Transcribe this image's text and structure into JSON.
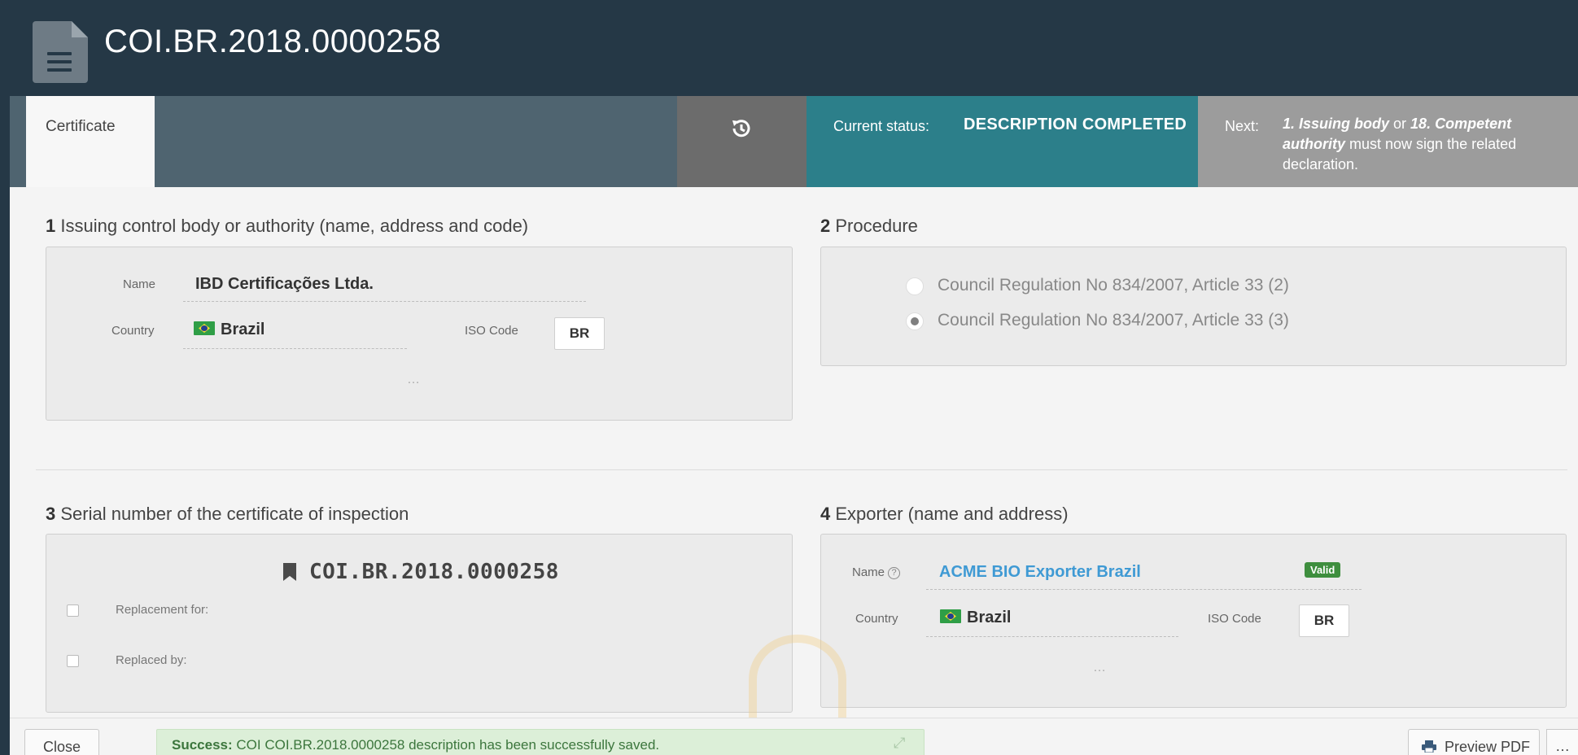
{
  "header": {
    "title": "COI.BR.2018.0000258"
  },
  "tabs": {
    "certificate": "Certificate"
  },
  "status": {
    "current_label": "Current status:",
    "current_value": "DESCRIPTION COMPLETED",
    "next_label": "Next:",
    "next_part1": "1. Issuing body",
    "next_or": " or ",
    "next_part2": "18. Competent authority",
    "next_rest": " must now sign the related declaration."
  },
  "section1": {
    "number": "1",
    "title": "Issuing control body or authority (name, address and code)",
    "name_label": "Name",
    "name_value": "IBD Certificações Ltda.",
    "country_label": "Country",
    "country_value": "Brazil",
    "iso_label": "ISO Code",
    "iso_value": "BR",
    "more": "…"
  },
  "section2": {
    "number": "2",
    "title": "Procedure",
    "options": [
      "Council Regulation No 834/2007, Article 33 (2)",
      "Council Regulation No 834/2007, Article 33 (3)"
    ],
    "selected_index": 1
  },
  "section3": {
    "number": "3",
    "title": "Serial number of the certificate of inspection",
    "serial": "COI.BR.2018.0000258",
    "replacement_for": "Replacement for:",
    "replaced_by": "Replaced by:"
  },
  "section4": {
    "number": "4",
    "title": "Exporter (name and address)",
    "name_label": "Name",
    "help": "?",
    "name_value": "ACME BIO Exporter Brazil",
    "badge": "Valid",
    "country_label": "Country",
    "country_value": "Brazil",
    "iso_label": "ISO Code",
    "iso_value": "BR",
    "more": "…"
  },
  "footer": {
    "close": "Close",
    "alert_bold": "Success:",
    "alert_text": " COI COI.BR.2018.0000258 description has been successfully saved.",
    "preview": "Preview PDF",
    "more": "…"
  },
  "colors": {
    "header_bg": "#253846",
    "status_bg": "#2c7f8a",
    "next_bg": "#9c9c9c",
    "success_bg": "#dcefd8",
    "link": "#3f9ad4",
    "valid_badge": "#3e8e3e"
  },
  "icons": [
    "document-icon",
    "history-icon",
    "bookmark-icon",
    "help-icon",
    "flag-brazil-icon",
    "printer-icon",
    "expand-icon"
  ]
}
